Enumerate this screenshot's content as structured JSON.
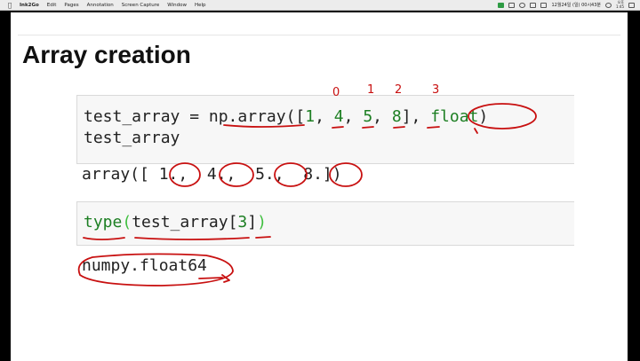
{
  "menubar": {
    "app_name": "Ink2Go",
    "items": [
      "Edit",
      "Pages",
      "Annotation",
      "Screen Capture",
      "Window",
      "Help"
    ],
    "status_text": "12월24일 (일)  00시43분",
    "clock_top": "오후",
    "clock_bottom": "1:45"
  },
  "slide": {
    "title": "Array creation",
    "cell1": {
      "line1_a": "test_array = np.array([",
      "line1_n1": "1",
      "line1_sep1": ", ",
      "line1_n2": "4",
      "line1_sep2": ", ",
      "line1_n3": "5",
      "line1_sep3": ", ",
      "line1_n4": "8",
      "line1_b": "], ",
      "line1_kw": "float",
      "line1_c": ")",
      "line2": "test_array"
    },
    "out1": "array([ 1.,  4.,  5.,  8.])",
    "cell2": {
      "builtin": "type",
      "open": "(",
      "middle": "test_array[",
      "num": "3",
      "close_bracket": "]",
      "close": ")"
    },
    "out2": "numpy.float64",
    "index_labels": [
      "0",
      "1",
      "2",
      "3"
    ]
  },
  "colors": {
    "ink_red": "#c81010",
    "code_green": "#1d7f23",
    "cell_bg": "#f7f7f7"
  }
}
